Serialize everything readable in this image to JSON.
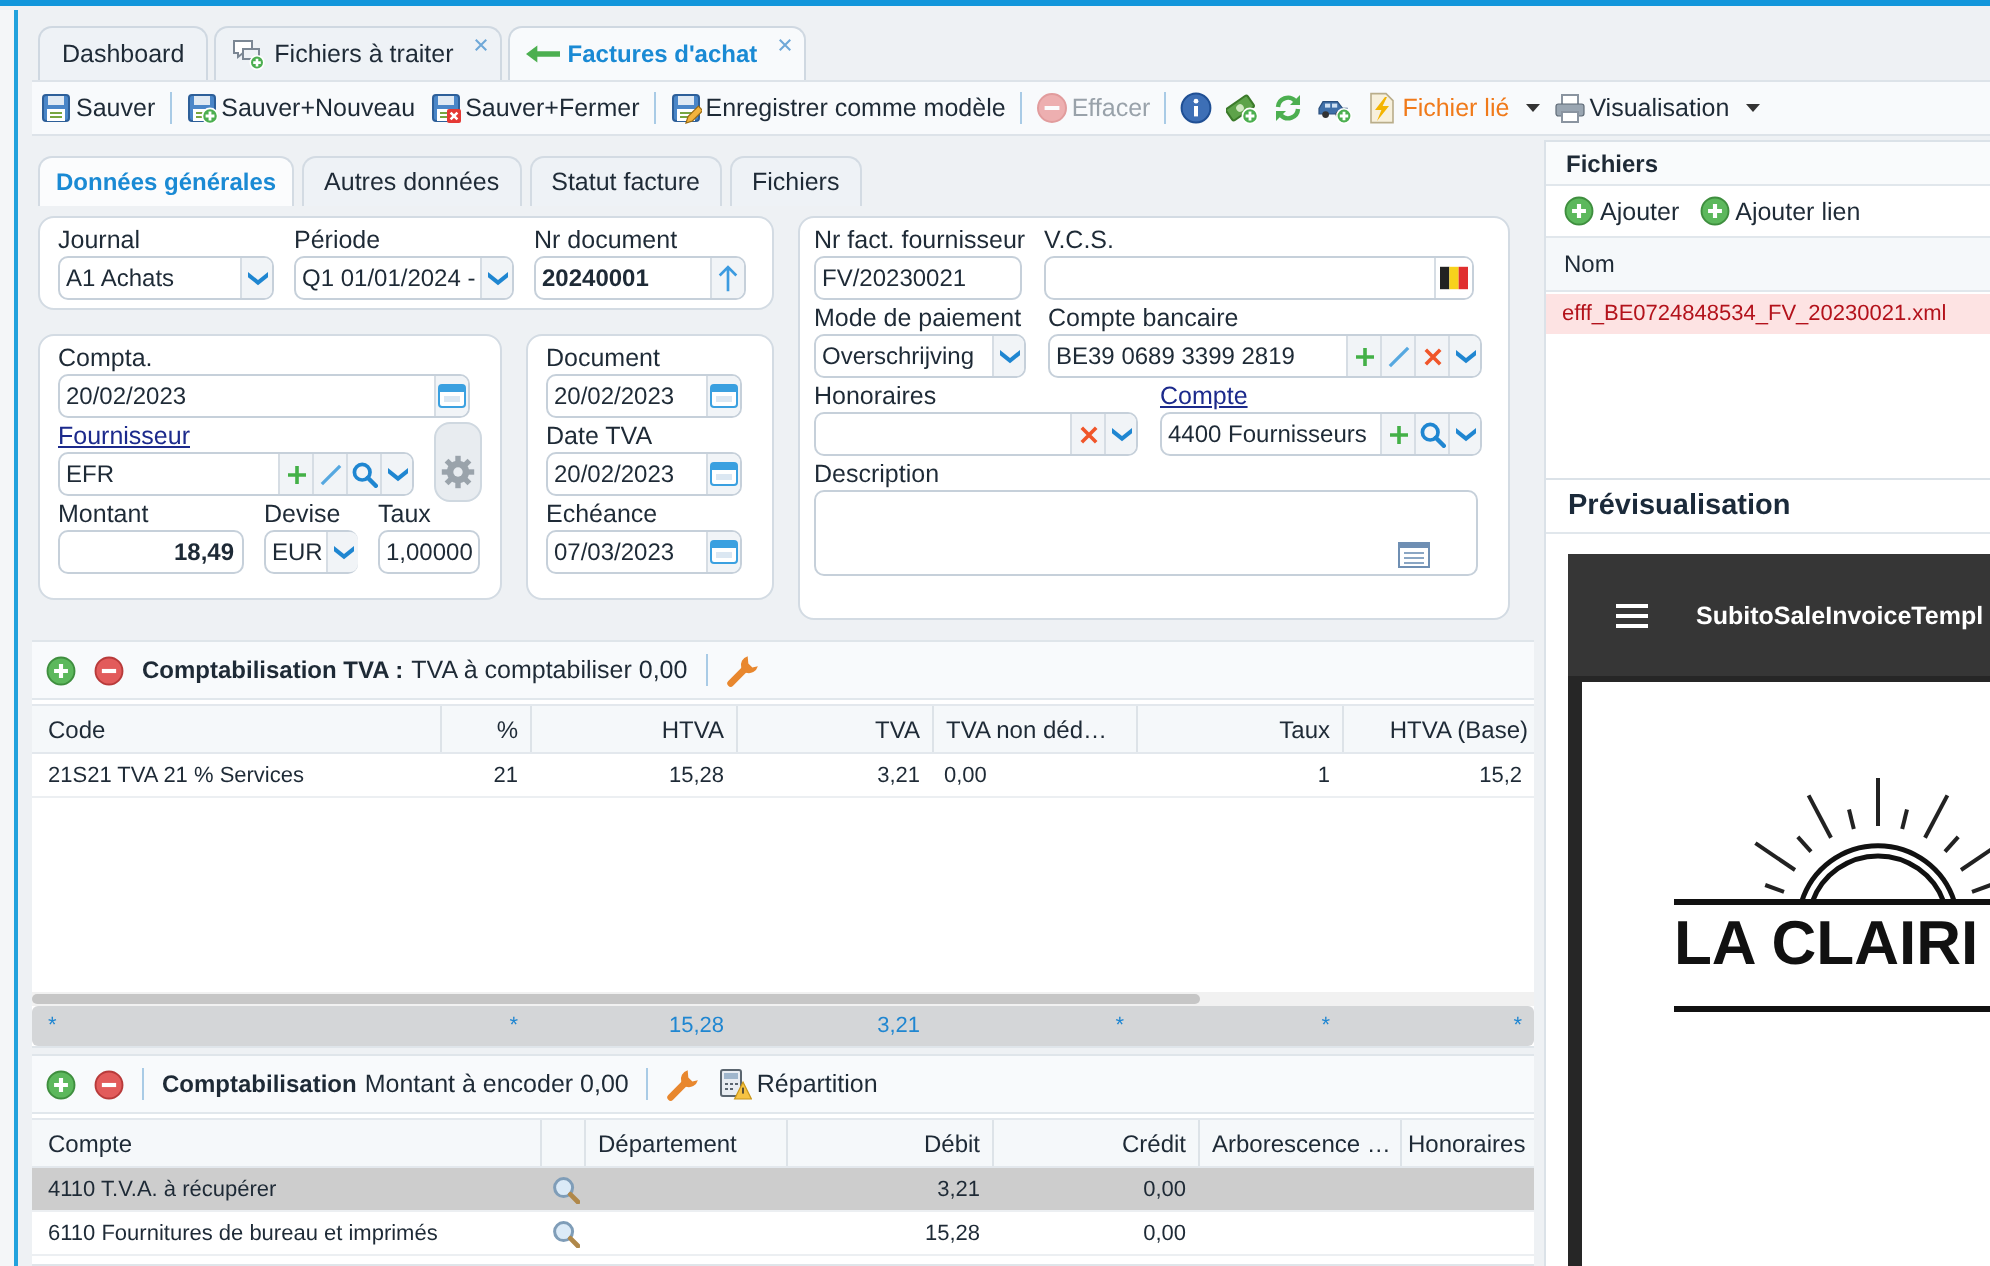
{
  "tabs": [
    {
      "kind": "plain",
      "label": "Dashboard",
      "selected": false,
      "closable": false
    },
    {
      "kind": "files",
      "label": "Fichiers à traiter",
      "selected": false,
      "closable": true
    },
    {
      "kind": "purchases",
      "label": "Factures d'achat",
      "selected": true,
      "closable": true
    }
  ],
  "toolbar": [
    {
      "kind": "button",
      "label": "Sauver",
      "disabled": false,
      "highlighted": false
    },
    {
      "kind": "separator"
    },
    {
      "kind": "button",
      "label": "Sauver+Nouveau",
      "disabled": false,
      "highlighted": false
    },
    {
      "kind": "button",
      "label": "Sauver+Fermer",
      "disabled": false,
      "highlighted": false
    },
    {
      "kind": "separator"
    },
    {
      "kind": "button",
      "label": "Enregistrer comme modèle",
      "disabled": false,
      "highlighted": false
    },
    {
      "kind": "separator"
    },
    {
      "kind": "button",
      "label": "Effacer",
      "disabled": true,
      "highlighted": false
    },
    {
      "kind": "separator"
    },
    {
      "kind": "icon"
    },
    {
      "kind": "icon"
    },
    {
      "kind": "icon"
    },
    {
      "kind": "icon"
    },
    {
      "kind": "menu",
      "label": "Fichier lié",
      "disabled": false,
      "highlighted": true
    },
    {
      "kind": "menu",
      "label": "Visualisation",
      "disabled": false,
      "highlighted": false
    }
  ],
  "form_tabs": [
    {
      "label": "Données générales",
      "selected": true
    },
    {
      "label": "Autres données",
      "selected": false
    },
    {
      "label": "Statut facture",
      "selected": false
    },
    {
      "label": "Fichiers",
      "selected": false
    }
  ],
  "form_groups": [
    {
      "rows": [
        [
          {
            "kind": "text",
            "label": "Journal",
            "link": false,
            "value": "A1 Achats",
            "buttons": [
              {
                "kind": "dropdown"
              }
            ]
          },
          {
            "kind": "text",
            "label": "Période",
            "link": false,
            "value": "Q1 01/01/2024 -",
            "buttons": [
              {
                "kind": "dropdown"
              }
            ]
          },
          {
            "kind": "number",
            "label": "Nr document",
            "link": false,
            "value": "20240001",
            "buttons": [
              {
                "kind": "increment"
              }
            ]
          }
        ]
      ]
    },
    {
      "rows": [
        [
          {
            "kind": "text",
            "label": "Compta.",
            "link": false,
            "value": "20/02/2023",
            "buttons": [
              {
                "kind": "calendar"
              }
            ]
          }
        ],
        [
          {
            "kind": "text",
            "label": "Fournisseur",
            "link": true,
            "value": "EFR",
            "buttons": [
              {
                "kind": "add"
              },
              {
                "kind": "edit"
              },
              {
                "kind": "search"
              },
              {
                "kind": "dropdown"
              }
            ]
          },
          {
            "kind": "settings"
          }
        ],
        [
          {
            "kind": "amount",
            "label": "Montant",
            "link": false,
            "value": "18,49"
          },
          {
            "kind": "text",
            "label": "Devise",
            "link": false,
            "value": "EUR",
            "buttons": [
              {
                "kind": "dropdown"
              }
            ]
          },
          {
            "kind": "text",
            "label": "Taux",
            "link": false,
            "value": "1,00000"
          }
        ]
      ]
    },
    {
      "rows": [
        [
          {
            "kind": "text",
            "label": "Document",
            "link": false,
            "value": "20/02/2023",
            "buttons": [
              {
                "kind": "calendar"
              }
            ]
          }
        ],
        [
          {
            "kind": "text",
            "label": "Date TVA",
            "link": false,
            "value": "20/02/2023",
            "buttons": [
              {
                "kind": "calendar"
              }
            ]
          }
        ],
        [
          {
            "kind": "text",
            "label": "Echéance",
            "link": false,
            "value": "07/03/2023",
            "buttons": [
              {
                "kind": "calendar"
              }
            ]
          }
        ]
      ]
    },
    {
      "rows": [
        [
          {
            "kind": "text",
            "label": "Nr fact. fournisseur",
            "link": false,
            "value": "FV/20230021"
          },
          {
            "kind": "text",
            "label": "V.C.S.",
            "link": false,
            "buttons": [
              {
                "kind": "flag"
              }
            ]
          }
        ],
        [
          {
            "kind": "text",
            "label": "Mode de paiement",
            "link": false,
            "value": "Overschrijving",
            "buttons": [
              {
                "kind": "dropdown"
              }
            ]
          },
          {
            "kind": "text",
            "label": "Compte bancaire",
            "link": false,
            "value": "BE39 0689 3399 2819",
            "buttons": [
              {
                "kind": "add"
              },
              {
                "kind": "edit"
              },
              {
                "kind": "clear"
              },
              {
                "kind": "dropdown"
              }
            ]
          }
        ],
        [
          {
            "kind": "text",
            "label": "Honoraires",
            "link": false,
            "buttons": [
              {
                "kind": "clear"
              },
              {
                "kind": "dropdown"
              }
            ]
          },
          {
            "kind": "text",
            "label": "Compte",
            "link": true,
            "value": "4400 Fournisseurs",
            "buttons": [
              {
                "kind": "add"
              },
              {
                "kind": "search"
              },
              {
                "kind": "dropdown"
              }
            ]
          }
        ],
        [
          {
            "kind": "memo",
            "label": "Description",
            "link": false
          }
        ]
      ]
    }
  ],
  "vat_section": {
    "toolbar": [
      {
        "kind": "add"
      },
      {
        "kind": "remove"
      },
      {
        "kind": "title",
        "label": "Comptabilisation TVA :",
        "summary": "TVA à comptabiliser 0,00"
      },
      {
        "kind": "separator"
      },
      {
        "kind": "settings"
      }
    ],
    "columns": [
      "Code",
      "%",
      "HTVA",
      "TVA",
      "TVA non déd…",
      "Taux",
      "HTVA (Base)"
    ],
    "rows": [
      {
        "selected": false,
        "cells": [
          "21S21 TVA 21 % Services",
          "21",
          "15,28",
          "3,21",
          "0,00",
          "1",
          "15,2"
        ]
      }
    ],
    "totals": [
      "*",
      "*",
      "15,28",
      "3,21",
      "*",
      "*",
      "*"
    ]
  },
  "entries_section": {
    "toolbar": [
      {
        "kind": "add"
      },
      {
        "kind": "remove"
      },
      {
        "kind": "separator"
      },
      {
        "kind": "title",
        "label": "Comptabilisation",
        "summary": "Montant à encoder 0,00"
      },
      {
        "kind": "separator"
      },
      {
        "kind": "settings"
      },
      {
        "kind": "button",
        "label": "Répartition"
      }
    ],
    "columns": [
      "Compte",
      "Département",
      "Débit",
      "Crédit",
      "Arborescence …",
      "Honoraires"
    ],
    "rows": [
      {
        "selected": true,
        "account": "4110 T.V.A. à récupérer",
        "debit": "3,21",
        "credit": "0,00"
      },
      {
        "selected": false,
        "account": "6110 Fournitures de bureau et imprimés",
        "debit": "15,28",
        "credit": "0,00"
      }
    ]
  },
  "files": {
    "title": "Fichiers",
    "actions": [
      "Ajouter",
      "Ajouter lien"
    ],
    "columns": [
      "Nom"
    ],
    "rows": [
      {
        "name": "efff_BE0724848534_FV_20230021.xml",
        "selected": true
      }
    ]
  },
  "preview": {
    "title": "Prévisualisation",
    "document_title": "SubitoSaleInvoiceTempl",
    "logo_text": "LA CLAIRI"
  }
}
